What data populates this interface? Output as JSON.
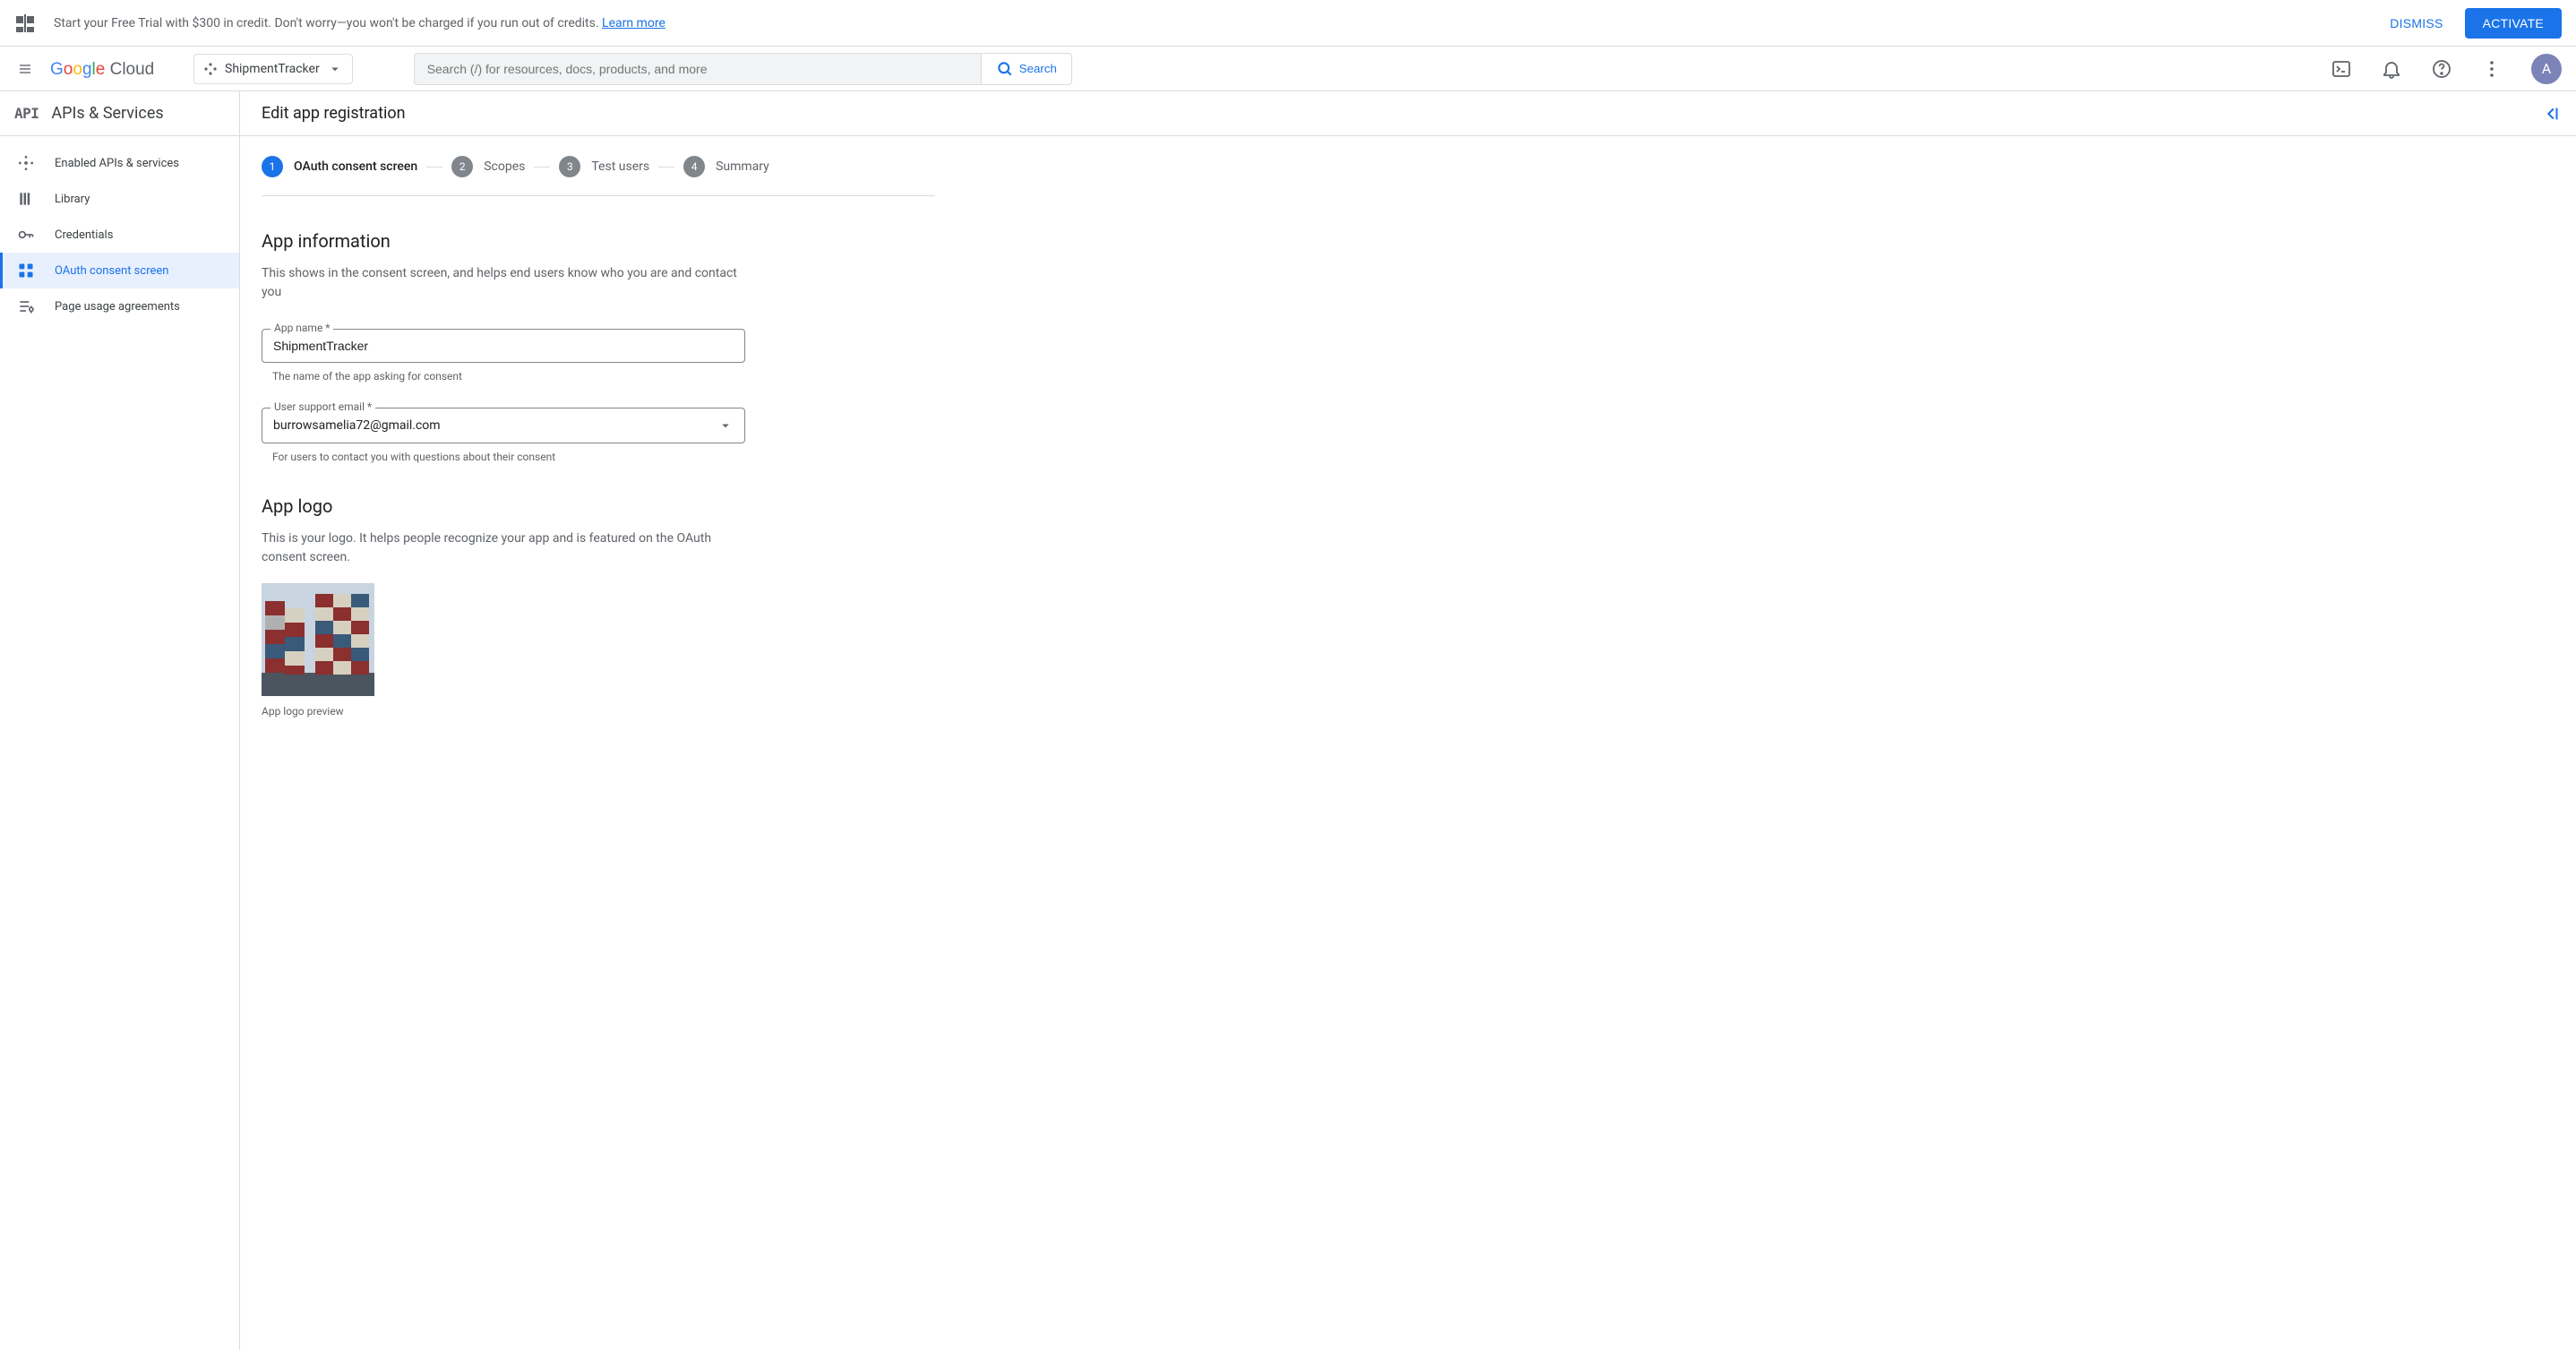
{
  "banner": {
    "text_prefix": "Start your Free Trial with $300 in credit. Don't worry—you won't be charged if you run out of credits. ",
    "learn_more": "Learn more",
    "dismiss": "DISMISS",
    "activate": "ACTIVATE"
  },
  "header": {
    "project_name": "ShipmentTracker",
    "search_placeholder": "Search (/) for resources, docs, products, and more",
    "search_button": "Search",
    "avatar_initial": "A"
  },
  "sidebar": {
    "title": "APIs & Services",
    "items": [
      {
        "label": "Enabled APIs & services"
      },
      {
        "label": "Library"
      },
      {
        "label": "Credentials"
      },
      {
        "label": "OAuth consent screen"
      },
      {
        "label": "Page usage agreements"
      }
    ]
  },
  "main": {
    "title": "Edit app registration",
    "stepper": [
      {
        "num": "1",
        "label": "OAuth consent screen"
      },
      {
        "num": "2",
        "label": "Scopes"
      },
      {
        "num": "3",
        "label": "Test users"
      },
      {
        "num": "4",
        "label": "Summary"
      }
    ],
    "app_info": {
      "heading": "App information",
      "desc": "This shows in the consent screen, and helps end users know who you are and contact you",
      "app_name_label": "App name *",
      "app_name_value": "ShipmentTracker",
      "app_name_helper": "The name of the app asking for consent",
      "email_label": "User support email *",
      "email_value": "burrowsamelia72@gmail.com",
      "email_helper": "For users to contact you with questions about their consent"
    },
    "app_logo": {
      "heading": "App logo",
      "desc": "This is your logo. It helps people recognize your app and is featured on the OAuth consent screen.",
      "caption": "App logo preview"
    }
  }
}
